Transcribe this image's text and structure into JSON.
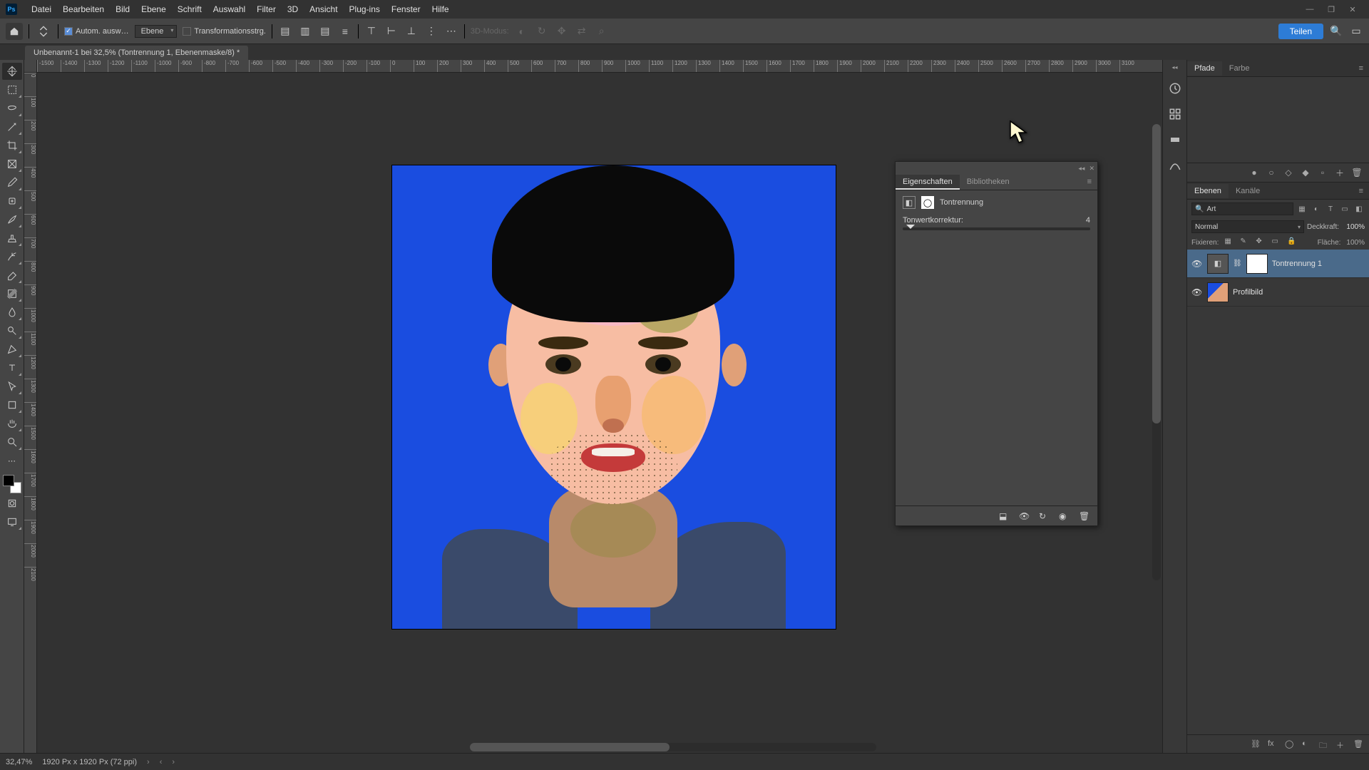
{
  "menubar": [
    "Datei",
    "Bearbeiten",
    "Bild",
    "Ebene",
    "Schrift",
    "Auswahl",
    "Filter",
    "3D",
    "Ansicht",
    "Plug-ins",
    "Fenster",
    "Hilfe"
  ],
  "optionsbar": {
    "auto_select": "Autom. ausw…",
    "target": "Ebene",
    "transform_controls": "Transformationsstrg.",
    "mode_label": "3D-Modus:"
  },
  "share_label": "Teilen",
  "document_tab": "Unbenannt-1 bei 32,5% (Tontrennung 1, Ebenenmaske/8) *",
  "ruler_h": [
    "-1500",
    "-1400",
    "-1300",
    "-1200",
    "-1100",
    "-1000",
    "-900",
    "-800",
    "-700",
    "-600",
    "-500",
    "-400",
    "-300",
    "-200",
    "-100",
    "0",
    "100",
    "200",
    "300",
    "400",
    "500",
    "600",
    "700",
    "800",
    "900",
    "1000",
    "1100",
    "1200",
    "1300",
    "1400",
    "1500",
    "1600",
    "1700",
    "1800",
    "1900",
    "2000",
    "2100",
    "2200",
    "2300",
    "2400",
    "2500",
    "2600",
    "2700",
    "2800",
    "2900",
    "3000",
    "3100"
  ],
  "ruler_v": [
    "0",
    "100",
    "200",
    "300",
    "400",
    "500",
    "600",
    "700",
    "800",
    "900",
    "1000",
    "1100",
    "1200",
    "1300",
    "1400",
    "1500",
    "1600",
    "1700",
    "1800",
    "1900",
    "2000",
    "2100"
  ],
  "right_dock": {
    "tabs_top": [
      "Pfade",
      "Farbe"
    ],
    "tabs_layers": [
      "Ebenen",
      "Kanäle"
    ],
    "filter_kind": "Art",
    "blend_mode": "Normal",
    "opacity_label": "Deckkraft:",
    "opacity_value": "100%",
    "lock_label": "Fixieren:",
    "fill_label": "Fläche:",
    "fill_value": "100%",
    "layers": [
      {
        "name": "Tontrennung 1",
        "selected": true,
        "has_mask": true
      },
      {
        "name": "Profilbild",
        "selected": false,
        "has_mask": false
      }
    ]
  },
  "float_panel": {
    "tabs": [
      "Eigenschaften",
      "Bibliotheken"
    ],
    "adjustment_name": "Tontrennung",
    "slider_label": "Tonwertkorrektur:",
    "slider_value": "4"
  },
  "statusbar": {
    "zoom": "32,47%",
    "doc_info": "1920 Px x 1920 Px (72 ppi)"
  }
}
